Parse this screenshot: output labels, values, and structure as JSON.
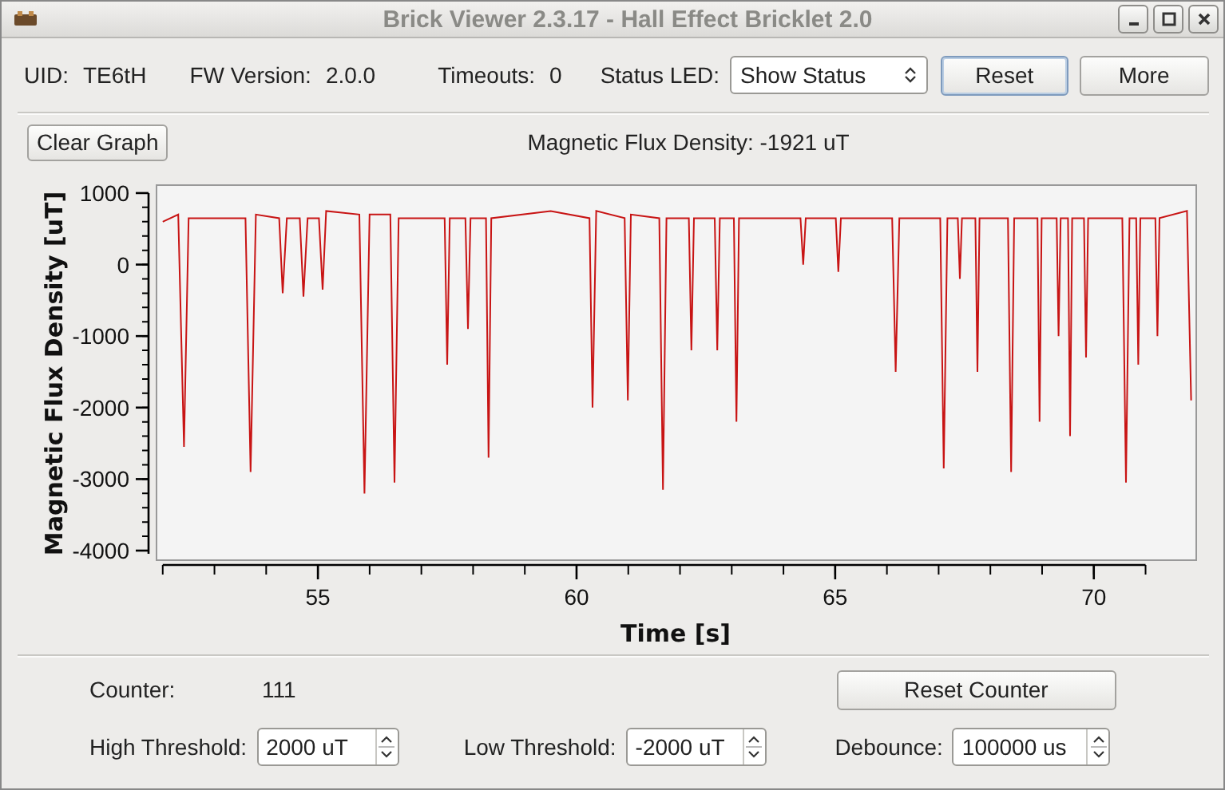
{
  "window": {
    "title": "Brick Viewer 2.3.17 - Hall Effect Bricklet 2.0"
  },
  "info": {
    "uid_label": "UID:",
    "uid": "TE6tH",
    "fw_label": "FW Version:",
    "fw": "2.0.0",
    "timeouts_label": "Timeouts:",
    "timeouts": "0",
    "status_led_label": "Status LED:",
    "status_led": "Show Status"
  },
  "buttons": [
    {
      "label": "Reset",
      "focused": true
    },
    {
      "label": "More",
      "focused": false
    }
  ],
  "graph": {
    "clear_button": "Clear Graph",
    "current_value": "Magnetic Flux Density: -1921 uT",
    "chart_data": {
      "type": "line",
      "xlabel": "Time [s]",
      "ylabel": "Magnetic Flux Density [uT]",
      "x": [
        52.0,
        52.3,
        52.41,
        52.5,
        53.6,
        53.7,
        53.8,
        54.25,
        54.32,
        54.4,
        54.65,
        54.72,
        54.8,
        55.02,
        55.09,
        55.16,
        55.8,
        55.9,
        56.0,
        56.4,
        56.48,
        56.56,
        57.45,
        57.5,
        57.55,
        57.85,
        57.9,
        57.95,
        58.25,
        58.3,
        58.35,
        59.5,
        60.25,
        60.31,
        60.38,
        60.93,
        60.99,
        61.05,
        61.6,
        61.67,
        61.74,
        62.17,
        62.22,
        62.27,
        62.67,
        62.72,
        62.77,
        63.04,
        63.09,
        63.14,
        64.33,
        64.38,
        64.43,
        65.01,
        65.06,
        65.11,
        66.1,
        66.17,
        66.24,
        67.03,
        67.1,
        67.17,
        67.37,
        67.41,
        67.45,
        67.71,
        67.75,
        67.79,
        68.34,
        68.4,
        68.46,
        68.91,
        68.95,
        68.99,
        69.28,
        69.32,
        69.36,
        69.5,
        69.54,
        69.58,
        69.81,
        69.85,
        69.89,
        70.55,
        70.62,
        70.69,
        70.82,
        70.86,
        70.9,
        71.19,
        71.23,
        71.27,
        71.8,
        71.88
      ],
      "series": [
        {
          "color": "#c81414",
          "values": [
            600,
            700,
            -2550,
            650,
            650,
            -2900,
            700,
            650,
            -400,
            650,
            650,
            -450,
            650,
            650,
            -350,
            750,
            700,
            -3200,
            700,
            700,
            -3050,
            650,
            650,
            -1400,
            650,
            650,
            -900,
            650,
            650,
            -2700,
            650,
            750,
            650,
            -2000,
            750,
            650,
            -1900,
            700,
            650,
            -3150,
            650,
            650,
            -1200,
            650,
            650,
            -1200,
            650,
            650,
            -2200,
            650,
            650,
            0,
            650,
            650,
            -100,
            650,
            650,
            -1500,
            650,
            650,
            -2850,
            650,
            650,
            -200,
            650,
            650,
            -1500,
            650,
            650,
            -2900,
            650,
            650,
            -2200,
            650,
            650,
            -1000,
            650,
            650,
            -2400,
            650,
            650,
            -1300,
            650,
            650,
            -3050,
            650,
            650,
            -1400,
            650,
            650,
            -1000,
            650,
            750,
            -1900
          ]
        }
      ],
      "xlim": [
        51.88,
        71.98
      ],
      "ylim": [
        -4134,
        1111
      ],
      "xticks": [
        55,
        60,
        65,
        70
      ],
      "yticks": [
        1000,
        0,
        -1000,
        -2000,
        -3000,
        -4000
      ]
    }
  },
  "counter": {
    "label": "Counter:",
    "value": "111"
  },
  "reset_counter": "Reset Counter",
  "settings": [
    {
      "label": "High Threshold:",
      "value": "2000 uT"
    },
    {
      "label": "Low Threshold:",
      "value": "-2000 uT"
    },
    {
      "label": "Debounce:",
      "value": "100000 us"
    }
  ]
}
